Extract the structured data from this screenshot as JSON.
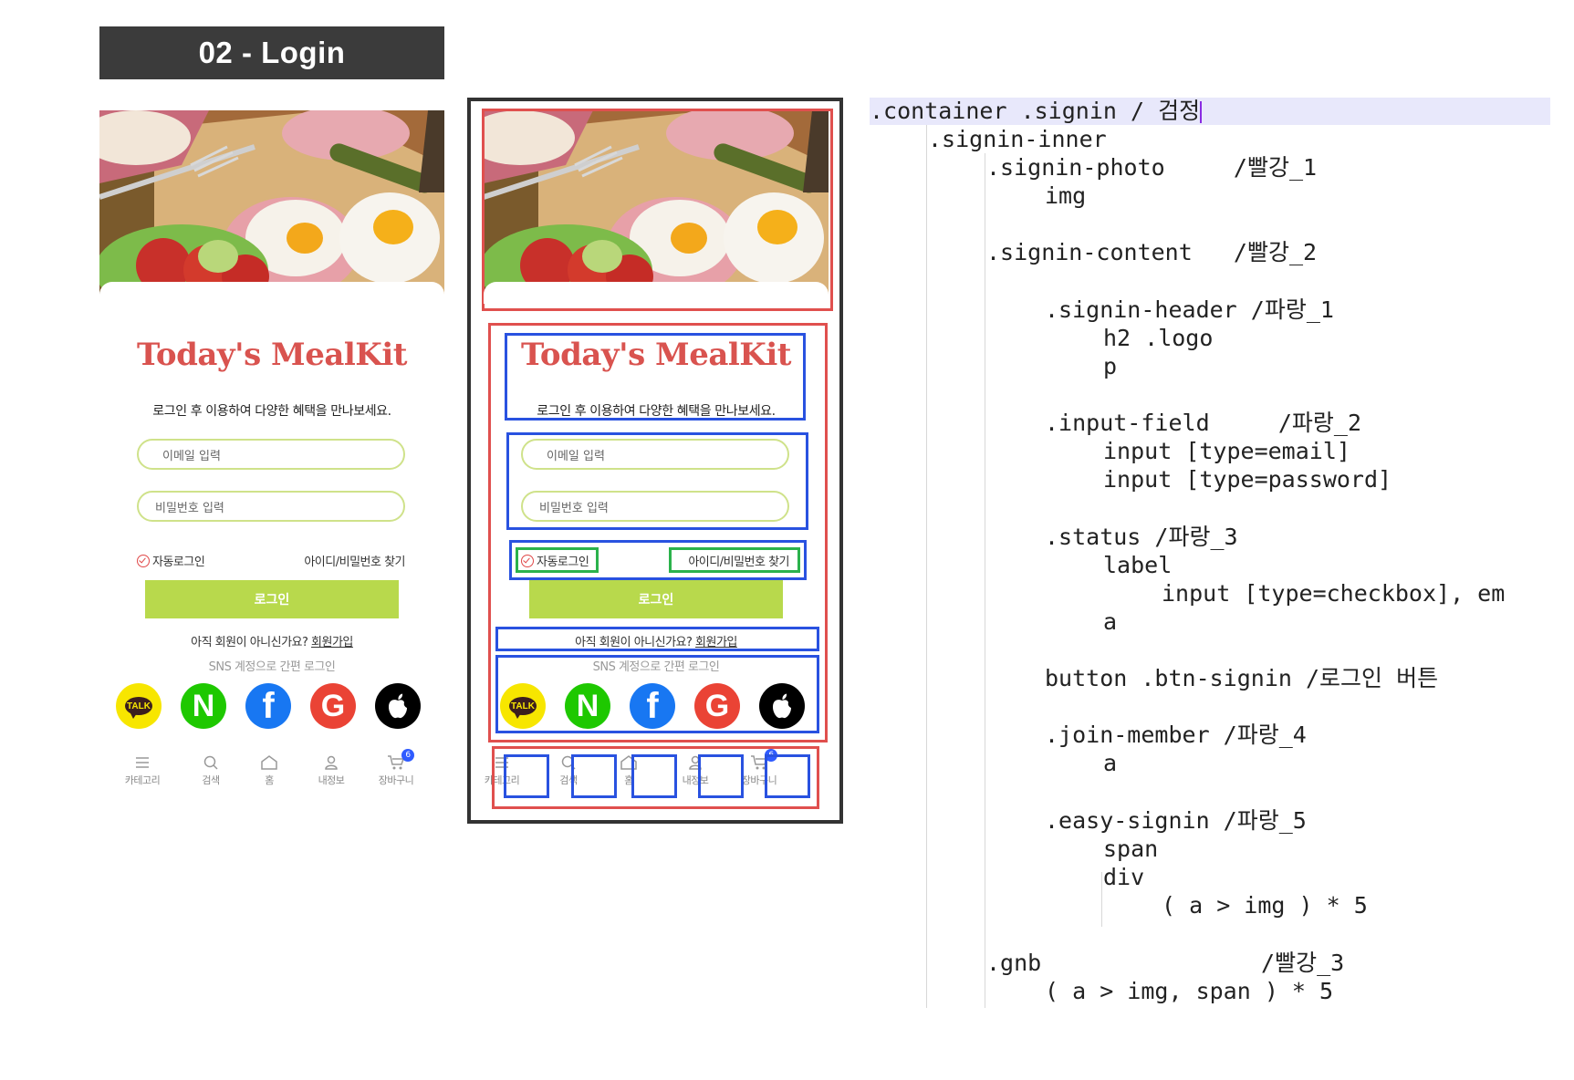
{
  "banner": {
    "title": "02 - Login"
  },
  "login": {
    "logo": "Today's MealKit",
    "subtitle": "로그인 후 이용하여 다양한 혜택을 만나보세요.",
    "email_placeholder": "이메일 입력",
    "password_placeholder": "비밀번호 입력",
    "auto_login": "자동로그인",
    "find_account": "아이디/비밀번호 찾기",
    "signin_button": "로그인",
    "join_prefix": "아직 회원이 아니신가요? ",
    "join_link": "회원가입",
    "easy_signin": "SNS 계정으로 간편 로그인",
    "sns": [
      {
        "name": "kakao",
        "label": "TALK"
      },
      {
        "name": "naver",
        "label": "N"
      },
      {
        "name": "facebook",
        "label": "f"
      },
      {
        "name": "google",
        "label": "G"
      },
      {
        "name": "apple",
        "label": ""
      }
    ],
    "gnb": [
      {
        "name": "category",
        "label": "카테고리",
        "icon": "menu-icon"
      },
      {
        "name": "search",
        "label": "검색",
        "icon": "search-icon"
      },
      {
        "name": "home",
        "label": "홈",
        "icon": "home-icon"
      },
      {
        "name": "my-info",
        "label": "내정보",
        "icon": "user-icon"
      },
      {
        "name": "cart",
        "label": "장바구니",
        "icon": "cart-icon",
        "badge": "6"
      }
    ]
  },
  "code": {
    "lines": [
      ".container .signin / 검정",
      ".signin-inner",
      ".signin-photo     /빨강_1",
      "img",
      ".signin-content   /빨강_2",
      ".signin-header /파랑_1",
      "h2 .logo",
      "p",
      ".input-field     /파랑_2",
      "input [type=email]",
      "input [type=password]",
      ".status /파랑_3",
      "label",
      "input [type=checkbox], em",
      "a",
      "button .btn-signin /로그인 버튼",
      ".join-member /파랑_4",
      "a",
      ".easy-signin /파랑_5",
      "span",
      "div",
      "( a > img ) * 5",
      ".gnb                /빨강_3",
      "( a > img, span ) * 5"
    ]
  }
}
